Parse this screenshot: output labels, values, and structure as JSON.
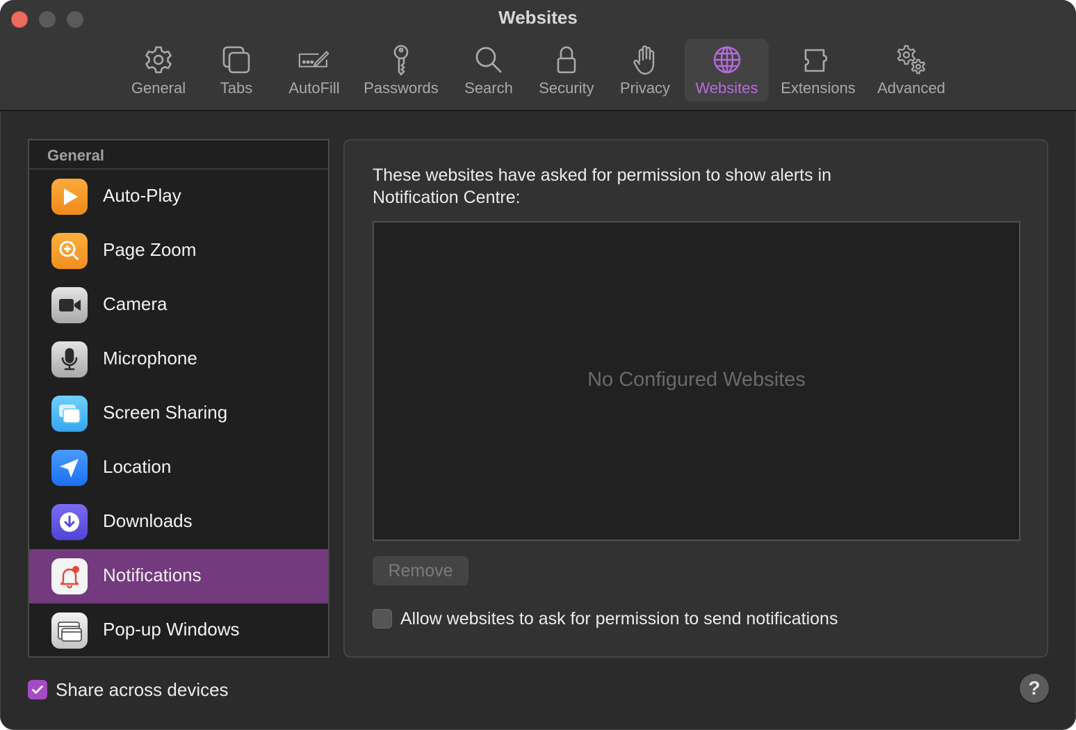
{
  "window": {
    "title": "Websites"
  },
  "toolbar": {
    "items": [
      {
        "label": "General",
        "icon": "gear-icon"
      },
      {
        "label": "Tabs",
        "icon": "tabs-icon"
      },
      {
        "label": "AutoFill",
        "icon": "autofill-icon"
      },
      {
        "label": "Passwords",
        "icon": "key-icon"
      },
      {
        "label": "Search",
        "icon": "search-icon"
      },
      {
        "label": "Security",
        "icon": "lock-icon"
      },
      {
        "label": "Privacy",
        "icon": "hand-icon"
      },
      {
        "label": "Websites",
        "icon": "globe-icon",
        "active": true
      },
      {
        "label": "Extensions",
        "icon": "puzzle-icon"
      },
      {
        "label": "Advanced",
        "icon": "gears-icon"
      }
    ]
  },
  "sidebar": {
    "header": "General",
    "items": [
      {
        "label": "Auto-Play",
        "icon": "play-icon"
      },
      {
        "label": "Page Zoom",
        "icon": "zoom-icon"
      },
      {
        "label": "Camera",
        "icon": "camera-icon"
      },
      {
        "label": "Microphone",
        "icon": "microphone-icon"
      },
      {
        "label": "Screen Sharing",
        "icon": "screen-sharing-icon"
      },
      {
        "label": "Location",
        "icon": "location-arrow-icon"
      },
      {
        "label": "Downloads",
        "icon": "download-icon"
      },
      {
        "label": "Notifications",
        "icon": "bell-icon",
        "selected": true
      },
      {
        "label": "Pop-up Windows",
        "icon": "popup-window-icon"
      }
    ]
  },
  "content": {
    "description": "These websites have asked for permission to show alerts in Notification Centre:",
    "empty_text": "No Configured Websites",
    "remove_label": "Remove",
    "allow_label": "Allow websites to ask for permission to send notifications",
    "allow_checked": false
  },
  "footer": {
    "share_label": "Share across devices",
    "share_checked": true,
    "help_label": "?"
  },
  "colors": {
    "accent": "#b76bd9",
    "selection": "#743a7e",
    "checkbox": "#a54ac4"
  }
}
